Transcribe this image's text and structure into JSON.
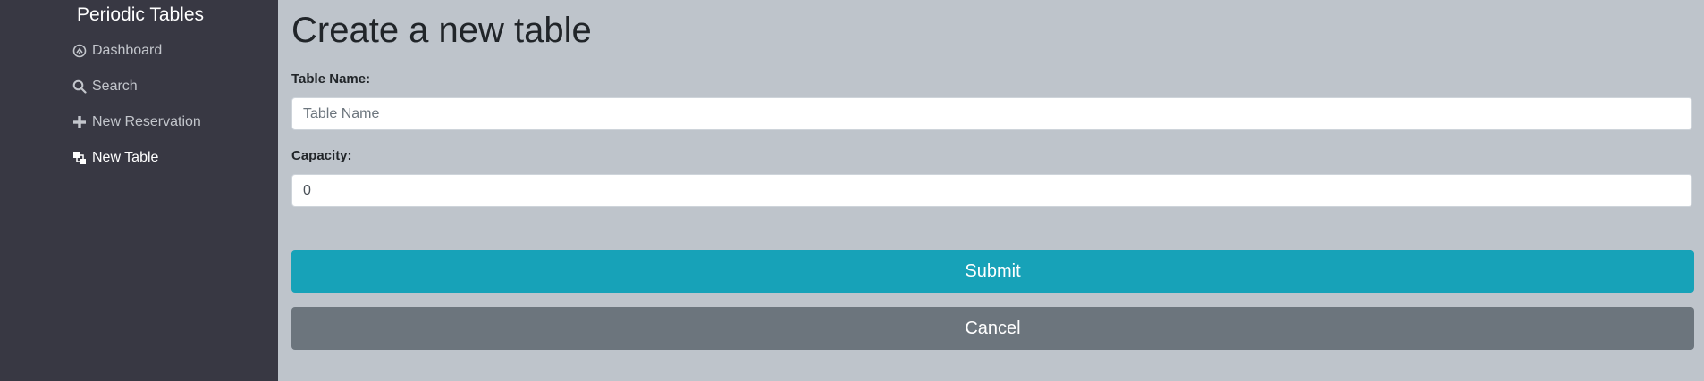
{
  "sidebar": {
    "brand": "Periodic Tables",
    "items": [
      {
        "label": "Dashboard",
        "icon": "dashboard-icon"
      },
      {
        "label": "Search",
        "icon": "search-icon"
      },
      {
        "label": "New Reservation",
        "icon": "plus-icon"
      },
      {
        "label": "New Table",
        "icon": "layers-icon",
        "active": true
      }
    ]
  },
  "main": {
    "title": "Create a new table",
    "form": {
      "table_name": {
        "label": "Table Name:",
        "placeholder": "Table Name",
        "value": ""
      },
      "capacity": {
        "label": "Capacity:",
        "value": "0"
      },
      "submit_label": "Submit",
      "cancel_label": "Cancel"
    }
  },
  "colors": {
    "sidebar_bg": "#383843",
    "main_bg": "#bec4cb",
    "submit": "#17a2b8",
    "cancel": "#6c757d"
  }
}
